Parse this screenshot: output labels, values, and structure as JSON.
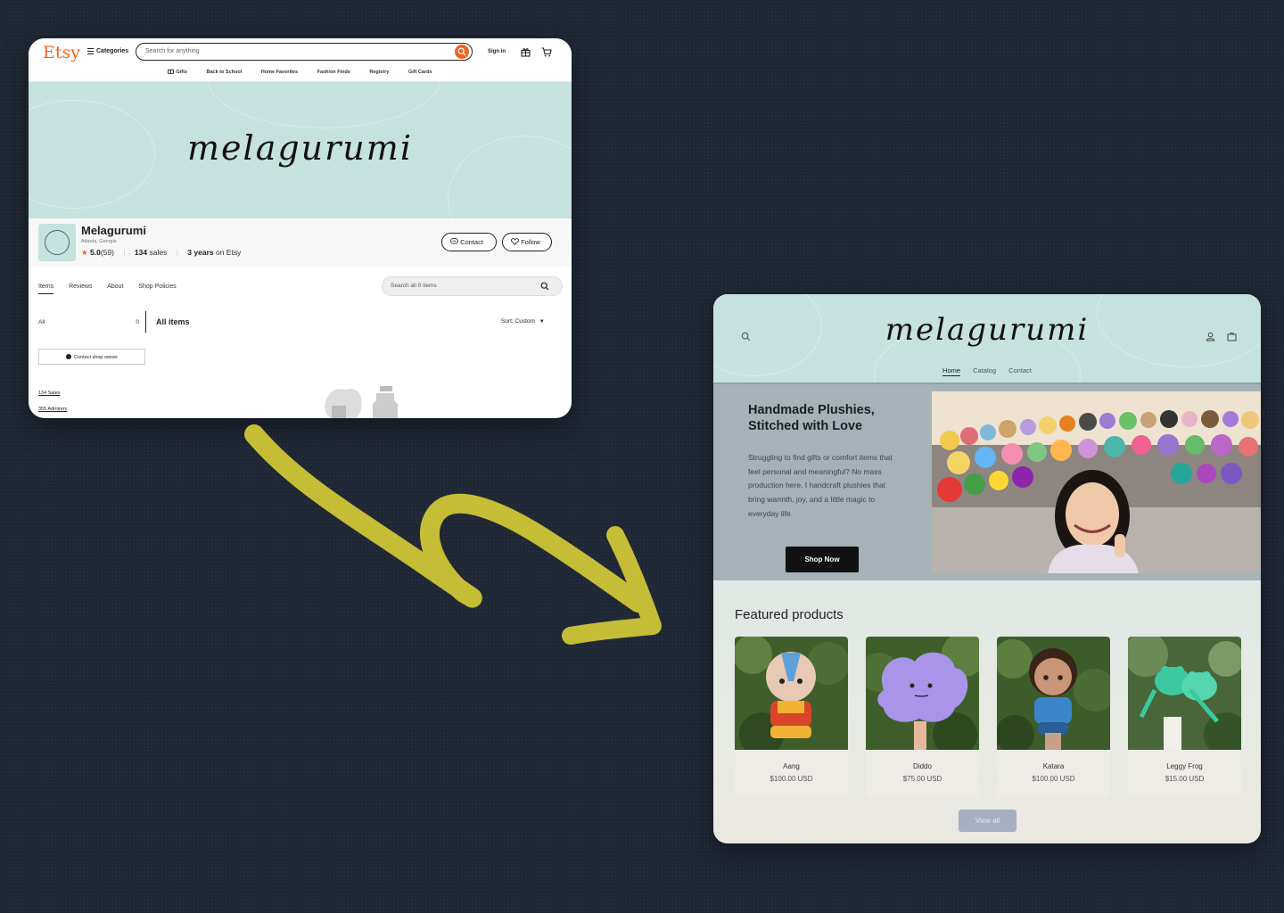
{
  "etsy": {
    "logo": "Etsy",
    "categories_label": "Categories",
    "search_placeholder": "Search for anything",
    "sign_in": "Sign in",
    "nav": [
      "Gifts",
      "Back to School",
      "Home Favorites",
      "Fashion Finds",
      "Registry",
      "Gift Cards"
    ],
    "banner_title": "melagurumi",
    "shop": {
      "name": "Melagurumi",
      "location": "Atlanta, Georgia",
      "rating": "5.0",
      "reviews": "(59)",
      "sales_count": "134",
      "sales_label": "sales",
      "years": "3 years",
      "years_suffix": "on Etsy",
      "contact_label": "Contact",
      "follow_label": "Follow"
    },
    "tabs": [
      "Items",
      "Reviews",
      "About",
      "Shop Policies"
    ],
    "shop_search_placeholder": "Search all 0 items",
    "sidebar_all": "All",
    "sidebar_all_count": "0",
    "all_items": "All items",
    "sort": "Sort: Custom",
    "contact_owner": "Contact shop owner",
    "sales_link": "134 Sales",
    "admirers_link": "355 Admirers"
  },
  "store": {
    "logo_title": "melagurumi",
    "nav": [
      "Home",
      "Catalog",
      "Contact"
    ],
    "hero_title": "Handmade Plushies, Stitched with Love",
    "hero_body": "Struggling to find gifts or comfort items that feel personal and meaningful? No mass production here, I handcraft plushies that bring warmth, joy, and a little magic to everyday life.",
    "shop_now": "Shop Now",
    "featured_title": "Featured products",
    "products": [
      {
        "name": "Aang",
        "price": "$100.00 USD"
      },
      {
        "name": "Diddo",
        "price": "$75.00 USD"
      },
      {
        "name": "Katara",
        "price": "$100.00 USD"
      },
      {
        "name": "Leggy Frog",
        "price": "$15.00 USD"
      }
    ],
    "view_all": "View all"
  },
  "colors": {
    "etsy_orange": "#f1641e",
    "banner_mint": "#c5e2de",
    "arrow": "#c4bd35",
    "background": "#1f2735"
  }
}
